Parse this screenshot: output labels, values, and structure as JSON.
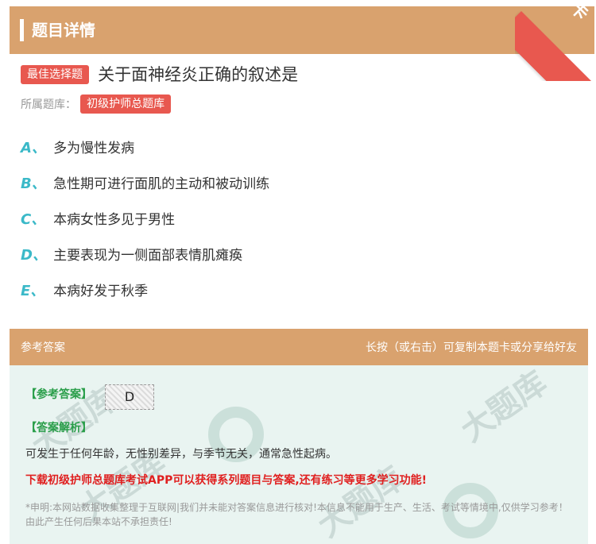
{
  "header": {
    "title": "题目详情"
  },
  "ribbon": {
    "text": "题卡"
  },
  "question": {
    "type_tag": "最佳选择题",
    "title": "关于面神经炎正确的叙述是",
    "library_label": "所属题库：",
    "library_name": "初级护师总题库"
  },
  "options": [
    {
      "letter": "A、",
      "text": "多为慢性发病"
    },
    {
      "letter": "B、",
      "text": "急性期可进行面肌的主动和被动训练"
    },
    {
      "letter": "C、",
      "text": "本病女性多见于男性"
    },
    {
      "letter": "D、",
      "text": "主要表现为一侧面部表情肌瘫痪"
    },
    {
      "letter": "E、",
      "text": "本病好发于秋季"
    }
  ],
  "answer_section": {
    "header_left": "参考答案",
    "header_right": "长按（或右击）可复制本题卡或分享给好友",
    "answer_label": "【参考答案】",
    "answer_value": "D",
    "explain_label": "【答案解析】",
    "explain_text": "可发生于任何年龄，无性别差异，与季节无关，通常急性起病。",
    "promo": "下载初级护师总题库考试APP可以获得系列题目与答案,还有练习等更多学习功能!",
    "disclaimer": "*申明:本网站数据收集整理于互联网|我们并未能对答案信息进行核对!本信息不能用于生产、生活、考试等情境中,仅供学习参考！由此产生任何后果本站不承担责任!"
  },
  "colors": {
    "header_bg": "#d9a26e",
    "tag_red": "#e8584f",
    "option_letter": "#3bb9c8",
    "answer_green": "#2a9e4a",
    "promo_red": "#e02020"
  }
}
